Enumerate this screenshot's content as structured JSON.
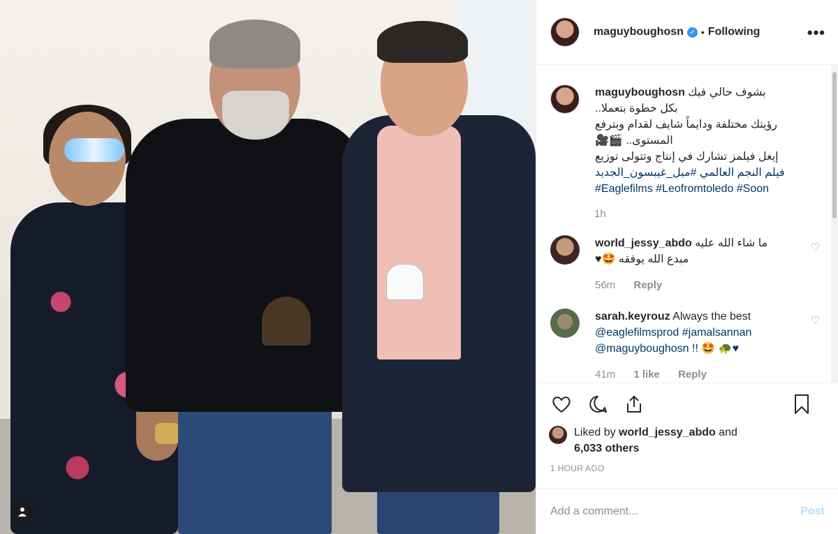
{
  "post": {
    "photo_alt": "",
    "tag_icon": "user-tag-icon"
  },
  "header": {
    "username": "maguyboughosn",
    "verified_mark": "✓",
    "separator": "•",
    "follow_status": "Following",
    "more_icon": "•••"
  },
  "caption": {
    "username": "maguyboughosn",
    "line1": "بشوف حالي فيك",
    "line2": "بكل خطوة بتعملا..",
    "line3": "رؤيتك مختلفة ودايماً شايف لقدام وبترفع",
    "line4": "المستوى.. 🎬🎥",
    "line5": "إيغل فيلمز تشارك في إنتاج وتتولى توزيع",
    "line6": "فيلم النجم العالمي #ميل_غيبسون_الجديد",
    "hashtags": "#Eaglefilms #Leofromtoledo #Soon",
    "time": "1h"
  },
  "comments": [
    {
      "username": "world_jessy_abdo",
      "text_line1": "ما شاء الله عليه",
      "text_line2": "مبدع الله يوفقه 🤩♥",
      "time": "56m",
      "reply": "Reply",
      "likes": ""
    },
    {
      "username": "sarah.keyrouz",
      "text_line1": "Always the best",
      "text_line2": "@eaglefilmsprod #jamalsannan",
      "text_line3": "@maguyboughosn !! 🤩 🐢♥",
      "time": "41m",
      "likes": "1 like",
      "reply": "Reply"
    }
  ],
  "actions": {
    "like_icon": "♡",
    "comment_icon": "◯",
    "share_icon": "⇪",
    "save_icon": "🔖"
  },
  "likes": {
    "prefix": "Liked by",
    "user": "world_jessy_abdo",
    "and": "and",
    "others": "6,033 others"
  },
  "timestamp": "1 HOUR AGO",
  "add_comment": {
    "placeholder": "Add a comment...",
    "post_label": "Post"
  },
  "colors": {
    "link": "#00376b",
    "verified": "#3897f0",
    "muted": "#8e8e8e",
    "post_disabled": "#b2dffc"
  }
}
